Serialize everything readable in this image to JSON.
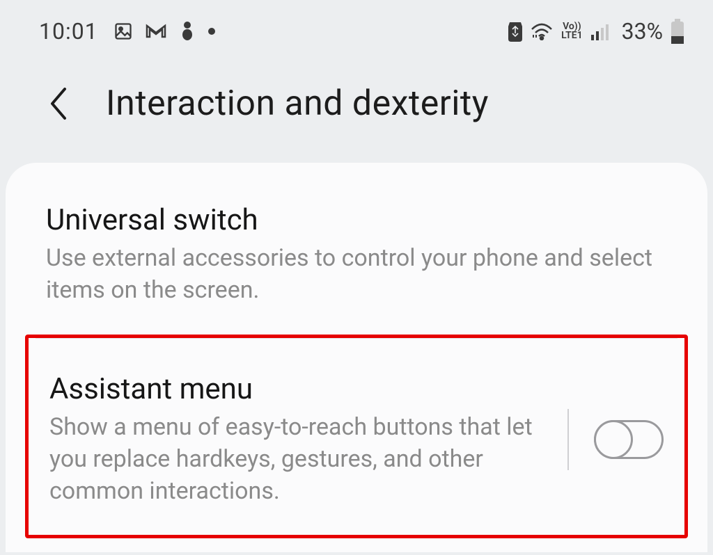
{
  "status": {
    "time": "10:01",
    "network_label_top": "Vo))",
    "network_label_bottom": "LTE1",
    "battery_pct": "33%"
  },
  "header": {
    "title": "Interaction and dexterity"
  },
  "items": [
    {
      "title": "Universal switch",
      "desc": "Use external accessories to control your phone and select items on the screen."
    },
    {
      "title": "Assistant menu",
      "desc": "Show a menu of easy-to-reach buttons that let you replace hardkeys, gestures, and other common interactions.",
      "toggle": false
    }
  ]
}
